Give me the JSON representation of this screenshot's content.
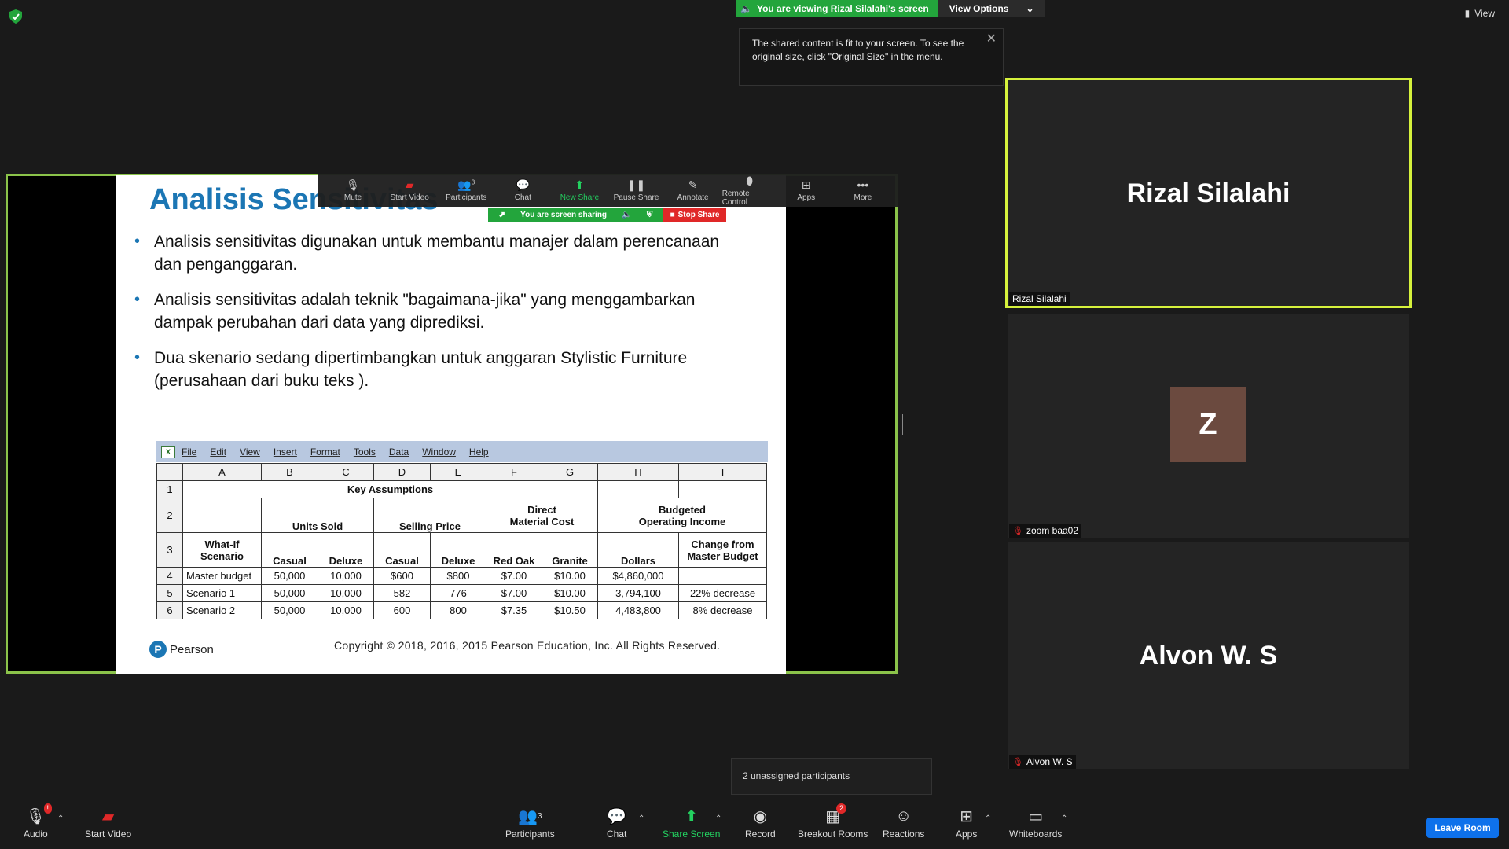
{
  "banner": {
    "viewing_text": "You are viewing Rizal Silalahi's screen",
    "view_options": "View Options",
    "view_top": "View"
  },
  "tooltip": {
    "text": "The shared content is fit to your screen. To see the original size, click \"Original Size\" in the menu."
  },
  "slide": {
    "title": "Analisis Sensitivitas",
    "bullets": [
      "Analisis sensitivitas digunakan untuk membantu manajer dalam perencanaan dan penganggaran.",
      "Analisis sensitivitas adalah teknik \"bagaimana-jika\" yang menggambarkan dampak perubahan dari data yang diprediksi.",
      "Dua skenario sedang dipertimbangkan untuk anggaran Stylistic Furniture (perusahaan dari buku teks )."
    ],
    "menu": [
      "File",
      "Edit",
      "View",
      "Insert",
      "Format",
      "Tools",
      "Data",
      "Window",
      "Help"
    ],
    "columns": [
      "A",
      "B",
      "C",
      "D",
      "E",
      "F",
      "G",
      "H",
      "I"
    ],
    "row1_title": "Key Assumptions",
    "row2": {
      "units_sold": "Units Sold",
      "selling_price": "Selling Price",
      "direct_cost_1": "Direct",
      "direct_cost_2": "Material Cost",
      "budgeted_1": "Budgeted",
      "budgeted_2": "Operating Income"
    },
    "row3": {
      "scenario_1": "What-If",
      "scenario_2": "Scenario",
      "casual_b": "Casual",
      "deluxe_c": "Deluxe",
      "casual_d": "Casual",
      "deluxe_e": "Deluxe",
      "red_oak": "Red Oak",
      "granite": "Granite",
      "dollars": "Dollars",
      "change_1": "Change from",
      "change_2": "Master Budget"
    },
    "rows": [
      {
        "num": "4",
        "a": "Master budget",
        "b": "50,000",
        "c": "10,000",
        "d": "$600",
        "e": "$800",
        "f": "$7.00",
        "g": "$10.00",
        "h": "$4,860,000",
        "i": ""
      },
      {
        "num": "5",
        "a": "Scenario 1",
        "b": "50,000",
        "c": "10,000",
        "d": "582",
        "e": "776",
        "f": "$7.00",
        "g": "$10.00",
        "h": "3,794,100",
        "i": "22% decrease"
      },
      {
        "num": "6",
        "a": "Scenario 2",
        "b": "50,000",
        "c": "10,000",
        "d": "600",
        "e": "800",
        "f": "$7.35",
        "g": "$10.50",
        "h": "4,483,800",
        "i": "8% decrease"
      }
    ],
    "publisher": "Pearson",
    "copyright": "Copyright © 2018, 2016, 2015 Pearson Education, Inc. All Rights Reserved."
  },
  "share_toolbar": {
    "mute": "Mute",
    "start_video": "Start Video",
    "participants": "Participants",
    "participants_count": "3",
    "chat": "Chat",
    "new_share": "New Share",
    "pause_share": "Pause Share",
    "annotate": "Annotate",
    "remote_control": "Remote Control",
    "apps": "Apps",
    "more": "More",
    "sharing_text": "You are screen sharing",
    "stop_share": "Stop Share"
  },
  "tiles": {
    "rizal": {
      "big": "Rizal Silalahi",
      "label": "Rizal Silalahi"
    },
    "zoom": {
      "avatar": "Z",
      "label": "zoom baa02"
    },
    "alvon": {
      "big": "Alvon W. S",
      "label": "Alvon W. S"
    }
  },
  "unassigned": "2 unassigned participants",
  "toolbar": {
    "audio": "Audio",
    "audio_badge": "!",
    "start_video": "Start Video",
    "participants": "Participants",
    "participants_count": "3",
    "chat": "Chat",
    "share_screen": "Share Screen",
    "record": "Record",
    "breakout_rooms": "Breakout Rooms",
    "breakout_badge": "2",
    "reactions": "Reactions",
    "apps": "Apps",
    "whiteboards": "Whiteboards",
    "leave": "Leave Room"
  },
  "colors": {
    "green": "#23a53c",
    "active_speaker": "#d6f23c",
    "share_border": "#8bc34a",
    "leave": "#0e71eb",
    "stop": "#e02828"
  }
}
